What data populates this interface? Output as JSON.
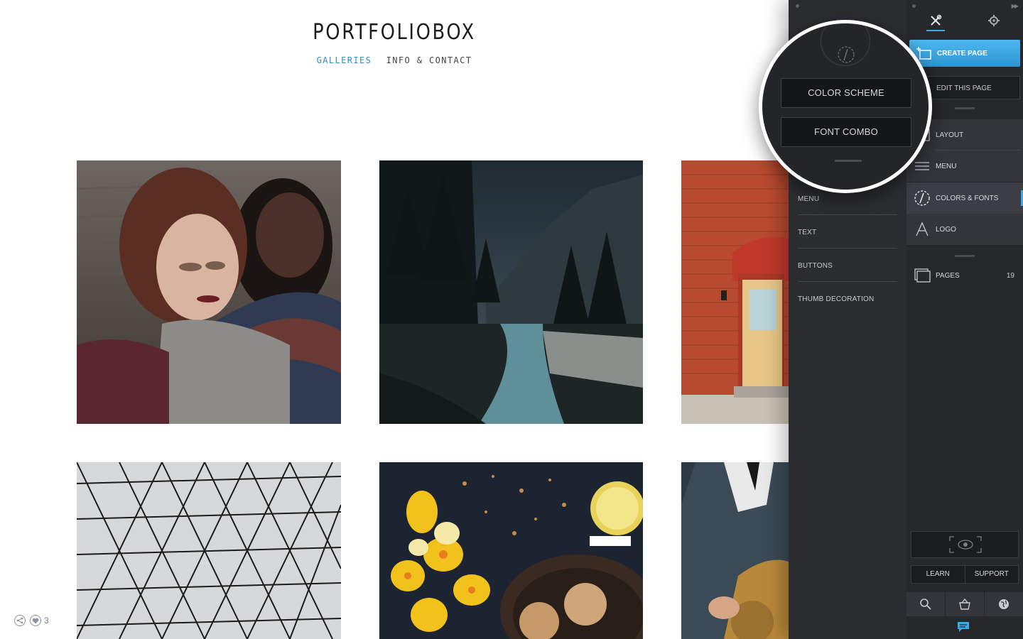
{
  "site": {
    "title": "PORTFOLIOBOX",
    "nav": [
      {
        "label": "GALLERIES",
        "active": true
      },
      {
        "label": "INFO & CONTACT",
        "active": false
      }
    ],
    "likes_count": "3"
  },
  "thumbnails": [
    {
      "name": "thumb-portrait-two-women"
    },
    {
      "name": "thumb-forest-river"
    },
    {
      "name": "thumb-red-wall-door"
    },
    {
      "name": "thumb-triangle-roof"
    },
    {
      "name": "thumb-flowers-cookies"
    },
    {
      "name": "thumb-saxophone-man"
    }
  ],
  "sub_panel": {
    "items": [
      "MENU",
      "TEXT",
      "BUTTONS",
      "THUMB DECORATION"
    ]
  },
  "magnifier": {
    "color_scheme": "COLOR SCHEME",
    "font_combo": "FONT COMBO"
  },
  "main_panel": {
    "create_page": "CREATE PAGE",
    "edit_page": "EDIT THIS PAGE",
    "menu": [
      {
        "label": "LAYOUT",
        "icon": "layout-icon"
      },
      {
        "label": "MENU",
        "icon": "menu-icon"
      },
      {
        "label": "COLORS & FONTS",
        "icon": "colors-fonts-icon",
        "active": true
      },
      {
        "label": "LOGO",
        "icon": "logo-icon"
      }
    ],
    "pages_label": "PAGES",
    "pages_count": "19",
    "learn": "LEARN",
    "support": "SUPPORT"
  },
  "colors": {
    "accent": "#3fa7e6",
    "panel": "#27282c",
    "subpanel": "#2b2c30"
  }
}
